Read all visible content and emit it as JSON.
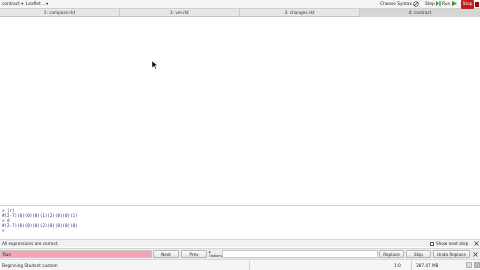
{
  "topbar": {
    "menu_left": "contract ▾",
    "menu_right": "Leaflet ...▾",
    "choose_syntax": "Choose Syntax",
    "step": "Step",
    "run": "Run",
    "stop": "Stop"
  },
  "tabs": [
    {
      "label": "1: compose.rkt",
      "active": false
    },
    {
      "label": "2: ver.rkt",
      "active": false
    },
    {
      "label": "3: changes.rkt",
      "active": false
    },
    {
      "label": "4: contract",
      "active": true
    }
  ],
  "repl": {
    "lines": [
      "> (r)",
      "#(2-7)(0)(0)(0)(1)(2)(0)(0)(1)",
      "> d",
      "#(2-7)(0)(0)(0)(2)(0)(0)(0)(0)",
      ">"
    ]
  },
  "status1": {
    "message": "All expressions are correct.",
    "checkbox_label": "Show next step"
  },
  "toolbar": {
    "find_value": "Run",
    "next_label": "Next",
    "prev_label": "Prev",
    "option_label": "Options",
    "replace_label": "Replace",
    "skip_label": "Skip",
    "undo_replace_label": "Undo Replace"
  },
  "status2": {
    "text": "Beginning Student custom",
    "position": "1:0",
    "memory": "387.47 MB"
  },
  "colors": {
    "stop": "#c21d1d",
    "find_field": "#f2a6b3",
    "repl_text": "#1d2a7a"
  }
}
